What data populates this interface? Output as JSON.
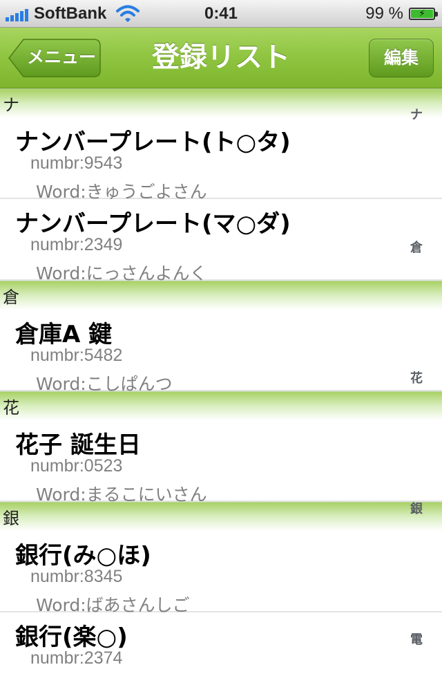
{
  "status_bar": {
    "carrier": "SoftBank",
    "time": "0:41",
    "battery_percent": "99 %",
    "battery_level": 0.99
  },
  "nav": {
    "back_label": "メニュー",
    "title": "登録リスト",
    "edit_label": "編集"
  },
  "sections": [
    {
      "header": "ナ",
      "rows": [
        {
          "title": "ナンバープレート(ト○タ)",
          "number": "numbr:9543",
          "word": "Word:きゅうごよさん"
        },
        {
          "title": "ナンバープレート(マ○ダ)",
          "number": "numbr:2349",
          "word": "Word:にっさんよんく"
        }
      ]
    },
    {
      "header": "倉",
      "rows": [
        {
          "title": "倉庫A 鍵",
          "number": "numbr:5482",
          "word": "Word:こしぱんつ"
        }
      ]
    },
    {
      "header": "花",
      "rows": [
        {
          "title": "花子 誕生日",
          "number": "numbr:0523",
          "word": "Word:まるこにいさん"
        }
      ]
    },
    {
      "header": "銀",
      "rows": [
        {
          "title": "銀行(み○ほ)",
          "number": "numbr:8345",
          "word": "Word:ばあさんしご"
        },
        {
          "title": "銀行(楽○)",
          "number": "numbr:2374",
          "word": ""
        }
      ]
    }
  ],
  "index": [
    "ナ",
    "倉",
    "花",
    "銀",
    "電"
  ]
}
